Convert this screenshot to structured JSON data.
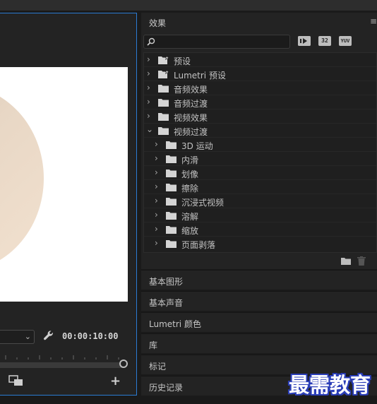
{
  "program_monitor": {
    "timecode": "00:00:10:00"
  },
  "effects_panel": {
    "title": "效果",
    "search": {
      "placeholder": ""
    },
    "filter_buttons": [
      {
        "icon": "accelerated-effects-icon",
        "label": ""
      },
      {
        "icon": "32bit-color-icon",
        "label": "32"
      },
      {
        "icon": "yuv-effects-icon",
        "label": "YUV"
      }
    ],
    "tree": [
      {
        "label": "预设",
        "expanded": false,
        "level": 0,
        "icon": "preset-folder-icon"
      },
      {
        "label": "Lumetri 预设",
        "expanded": false,
        "level": 0,
        "icon": "preset-folder-icon"
      },
      {
        "label": "音频效果",
        "expanded": false,
        "level": 0,
        "icon": "folder-icon"
      },
      {
        "label": "音频过渡",
        "expanded": false,
        "level": 0,
        "icon": "folder-icon"
      },
      {
        "label": "视频效果",
        "expanded": false,
        "level": 0,
        "icon": "folder-icon"
      },
      {
        "label": "视频过渡",
        "expanded": true,
        "level": 0,
        "icon": "folder-icon"
      },
      {
        "label": "3D 运动",
        "expanded": false,
        "level": 1,
        "icon": "folder-icon"
      },
      {
        "label": "内滑",
        "expanded": false,
        "level": 1,
        "icon": "folder-icon"
      },
      {
        "label": "划像",
        "expanded": false,
        "level": 1,
        "icon": "folder-icon"
      },
      {
        "label": "擦除",
        "expanded": false,
        "level": 1,
        "icon": "folder-icon"
      },
      {
        "label": "沉浸式视频",
        "expanded": false,
        "level": 1,
        "icon": "folder-icon"
      },
      {
        "label": "溶解",
        "expanded": false,
        "level": 1,
        "icon": "folder-icon"
      },
      {
        "label": "缩放",
        "expanded": false,
        "level": 1,
        "icon": "folder-icon"
      },
      {
        "label": "页面剥落",
        "expanded": false,
        "level": 1,
        "icon": "folder-icon"
      }
    ]
  },
  "panels": [
    {
      "label": "基本图形"
    },
    {
      "label": "基本声音"
    },
    {
      "label": "Lumetri 颜色"
    },
    {
      "label": "库"
    },
    {
      "label": "标记"
    },
    {
      "label": "历史记录"
    }
  ],
  "watermark": "最需教育",
  "colors": {
    "panel_bg": "#232323",
    "focus_border": "#2b7cd3",
    "watermark_outline": "#2b3eb8"
  }
}
